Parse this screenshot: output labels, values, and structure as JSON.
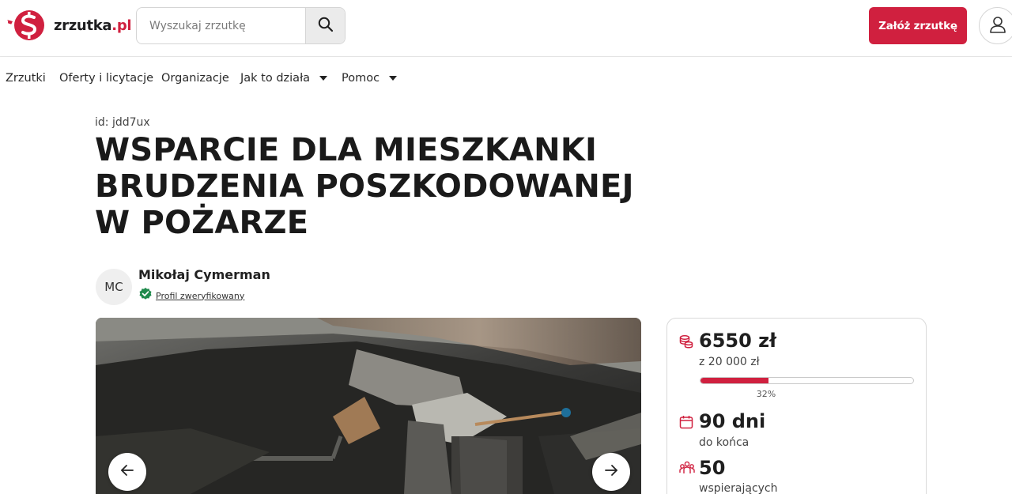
{
  "header": {
    "logo_text": "zrzutka",
    "logo_suffix": ".pl",
    "search_placeholder": "Wyszukaj zrzutkę",
    "cta_label": "Załóż zrzutkę"
  },
  "nav": {
    "items": [
      {
        "label": "Zrzutki",
        "dropdown": false
      },
      {
        "label": "Oferty i licytacje",
        "dropdown": false
      },
      {
        "label": "Organizacje",
        "dropdown": false
      },
      {
        "label": "Jak to działa",
        "dropdown": true
      },
      {
        "label": "Pomoc",
        "dropdown": true
      }
    ]
  },
  "fundraiser": {
    "id_text": "id: jdd7ux",
    "title": "WSPARCIE DLA MIESZKANKI BRUDZENIA POSZKODOWANEJ W POŻARZE",
    "author": {
      "initials": "MC",
      "name": "Mikołaj Cymerman",
      "verified_label": "Profil zweryfikowany"
    }
  },
  "stats": {
    "raised": "6550 zł",
    "goal": "z 20 000 zł",
    "progress_percent": 32,
    "percent_label": "32%",
    "days": "90 dni",
    "days_label": "do końca",
    "backers": "50",
    "backers_label": "wspierających"
  },
  "colors": {
    "brand": "#d0203f",
    "verified": "#1f8a4c"
  },
  "icons": {
    "search": "search-icon",
    "user": "user-icon",
    "prev": "arrow-left-icon",
    "next": "arrow-right-icon",
    "coins": "coins-icon",
    "calendar": "calendar-icon",
    "people": "people-icon",
    "verified": "verified-badge-icon"
  }
}
